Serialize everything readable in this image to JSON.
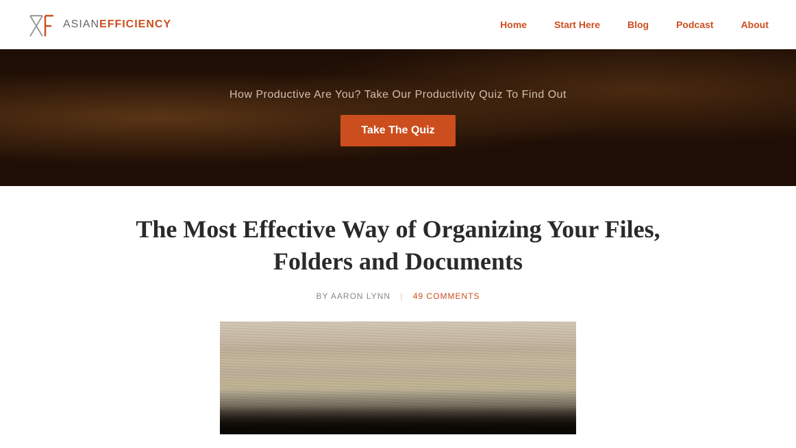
{
  "header": {
    "logo": {
      "text_asian": "ASIAN",
      "text_efficiency": "EFFICIENCY",
      "icon_label": "AE"
    },
    "nav": {
      "items": [
        {
          "label": "Home",
          "href": "#"
        },
        {
          "label": "Start Here",
          "href": "#"
        },
        {
          "label": "Blog",
          "href": "#"
        },
        {
          "label": "Podcast",
          "href": "#"
        },
        {
          "label": "About",
          "href": "#"
        }
      ]
    }
  },
  "banner": {
    "headline": "How Productive Are You? Take Our Productivity Quiz To Find Out",
    "cta_label": "Take The Quiz"
  },
  "article": {
    "title": "The Most Effective Way of Organizing Your Files, Folders and Documents",
    "author_label": "BY AARON LYNN",
    "comments_count": "49",
    "comments_label": "COMMENTS"
  }
}
